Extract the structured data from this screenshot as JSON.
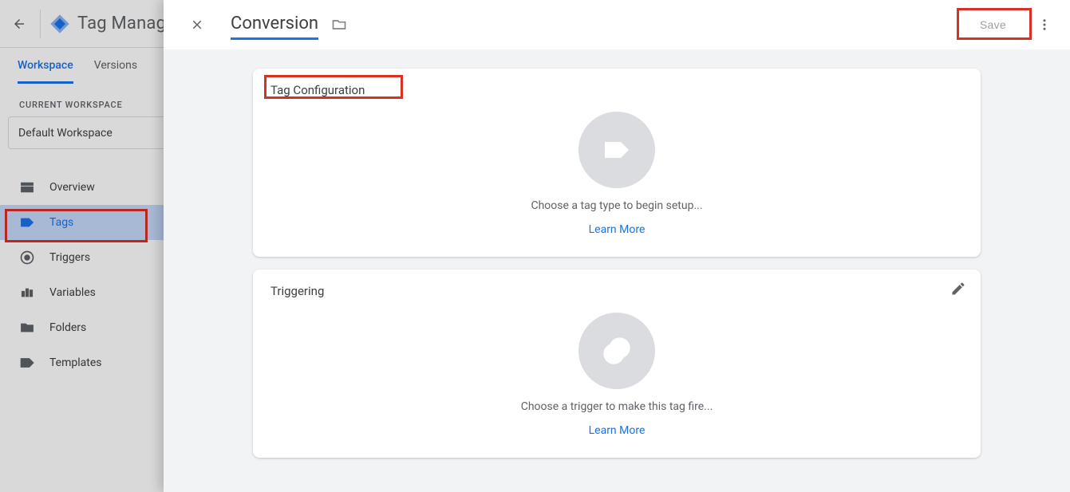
{
  "app_title": "Tag Manage",
  "tabs": {
    "workspace": "Workspace",
    "versions": "Versions"
  },
  "workspace_label": "CURRENT WORKSPACE",
  "workspace_name": "Default Workspace",
  "sidebar": {
    "overview": "Overview",
    "tags": "Tags",
    "triggers": "Triggers",
    "variables": "Variables",
    "folders": "Folders",
    "templates": "Templates"
  },
  "modal": {
    "tag_name": "Conversion",
    "save": "Save",
    "card1": {
      "title": "Tag Configuration",
      "hint": "Choose a tag type to begin setup...",
      "learn": "Learn More"
    },
    "card2": {
      "title": "Triggering",
      "hint": "Choose a trigger to make this tag fire...",
      "learn": "Learn More"
    }
  }
}
